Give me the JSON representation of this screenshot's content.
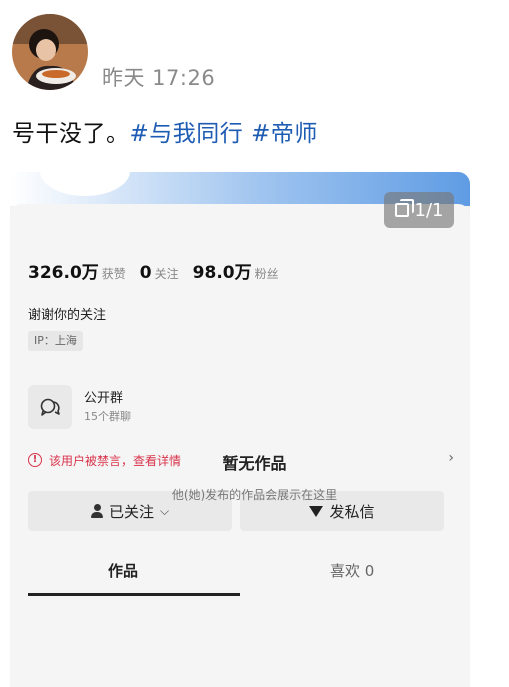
{
  "post": {
    "timestamp": "昨天 17:26",
    "text": "号干没了。",
    "hashtags": [
      "#与我同行",
      "#帝师"
    ]
  },
  "profile_card": {
    "page_indicator": "1/1",
    "stats": [
      {
        "value": "326.0万",
        "label": "获赞"
      },
      {
        "value": "0",
        "label": "关注"
      },
      {
        "value": "98.0万",
        "label": "粉丝"
      }
    ],
    "bio": "谢谢你的关注",
    "ip": "IP：上海",
    "group": {
      "title": "公开群",
      "subtitle": "15个群聊"
    },
    "ban_notice": "该用户被禁言，查看详情",
    "buttons": {
      "follow": "已关注",
      "message": "发私信"
    },
    "tabs": [
      "作品",
      "喜欢 0"
    ],
    "empty": {
      "title": "暂无作品",
      "subtitle": "他(她)发布的作品会展示在这里"
    }
  },
  "colors": {
    "hashtag": "#1e5bb3",
    "warning": "#d9344b"
  }
}
